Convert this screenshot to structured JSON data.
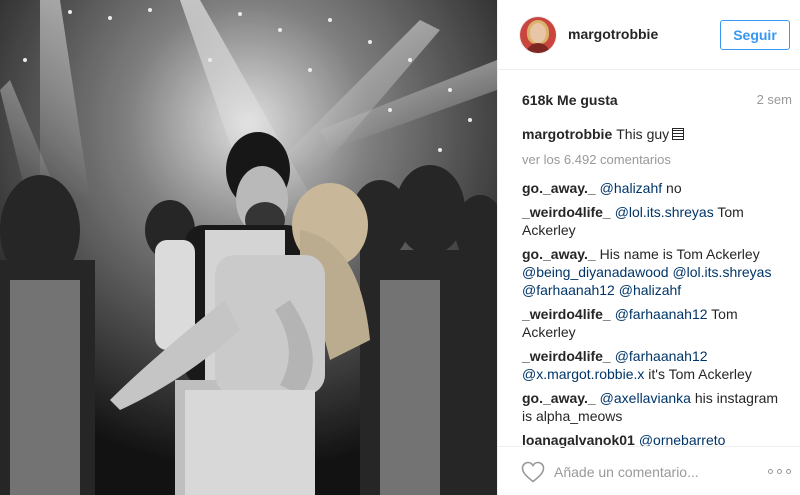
{
  "post": {
    "username": "margotrobbie",
    "follow_label": "Seguir",
    "likes": "618k Me gusta",
    "time_ago": "2 sem",
    "caption": {
      "user": "margotrobbie",
      "text": "This guy"
    },
    "view_all": "ver los 6.492 comentarios",
    "comments": [
      {
        "user": "go._away._",
        "parts": [
          {
            "t": "@halizahf",
            "m": true
          },
          {
            "t": " no",
            "m": false
          }
        ]
      },
      {
        "user": "_weirdo4life_",
        "parts": [
          {
            "t": "@lol.its.shreyas",
            "m": true
          },
          {
            "t": " Tom Ackerley",
            "m": false
          }
        ]
      },
      {
        "user": "go._away._",
        "parts": [
          {
            "t": "His name is Tom Ackerley ",
            "m": false
          },
          {
            "t": "@being_diyanadawood",
            "m": true
          },
          {
            "t": " ",
            "m": false
          },
          {
            "t": "@lol.its.shreyas",
            "m": true
          },
          {
            "t": " ",
            "m": false
          },
          {
            "t": "@farhaanah12",
            "m": true
          },
          {
            "t": " ",
            "m": false
          },
          {
            "t": "@halizahf",
            "m": true
          }
        ]
      },
      {
        "user": "_weirdo4life_",
        "parts": [
          {
            "t": "@farhaanah12",
            "m": true
          },
          {
            "t": " Tom Ackerley",
            "m": false
          }
        ]
      },
      {
        "user": "_weirdo4life_",
        "parts": [
          {
            "t": "@farhaanah12",
            "m": true
          },
          {
            "t": " ",
            "m": false
          },
          {
            "t": "@x.margot.robbie.x",
            "m": true
          },
          {
            "t": " it's Tom Ackerley",
            "m": false
          }
        ]
      },
      {
        "user": "go._away._",
        "parts": [
          {
            "t": "@axellavianka",
            "m": true
          },
          {
            "t": " his instagram is alpha_meows",
            "m": false
          }
        ]
      },
      {
        "user": "loanagalvanok01",
        "parts": [
          {
            "t": "@ornebarreto",
            "m": true
          }
        ]
      }
    ],
    "comment_placeholder": "Añade un comentario..."
  },
  "colors": {
    "accent": "#3897f0",
    "mention": "#003569",
    "muted": "#999999",
    "text": "#262626"
  },
  "icons": {
    "like": "heart-icon",
    "options": "more-options-icon"
  }
}
